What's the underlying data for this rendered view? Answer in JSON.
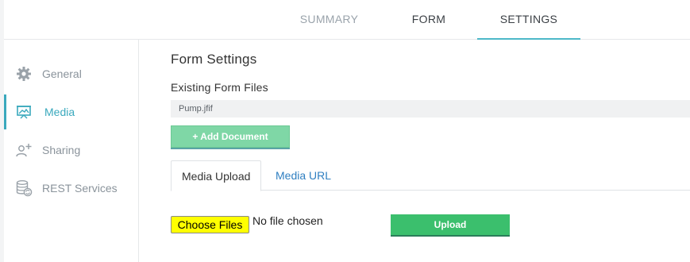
{
  "top_tabs": [
    {
      "label": "SUMMARY"
    },
    {
      "label": "FORM"
    },
    {
      "label": "SETTINGS",
      "active": true
    }
  ],
  "sidebar": {
    "items": [
      {
        "label": "General",
        "icon": "gear-icon"
      },
      {
        "label": "Media",
        "icon": "media-presentation-icon",
        "active": true
      },
      {
        "label": "Sharing",
        "icon": "add-user-icon"
      },
      {
        "label": "REST Services",
        "icon": "database-sync-icon"
      }
    ]
  },
  "main": {
    "title": "Form Settings",
    "existing_files_heading": "Existing Form Files",
    "files": [
      "Pump.jfif"
    ],
    "add_document_label": "+ Add Document",
    "subtabs": [
      {
        "label": "Media Upload",
        "active": true
      },
      {
        "label": "Media URL"
      }
    ],
    "choose_files_label": "Choose Files",
    "no_file_text": "No file chosen",
    "upload_label": "Upload"
  },
  "colors": {
    "accent": "#3aa9bd",
    "upload_green": "#3bbf6d",
    "add_doc_green": "#7fd7a6",
    "highlight": "#ffff00",
    "link_blue": "#2f7fc1"
  }
}
